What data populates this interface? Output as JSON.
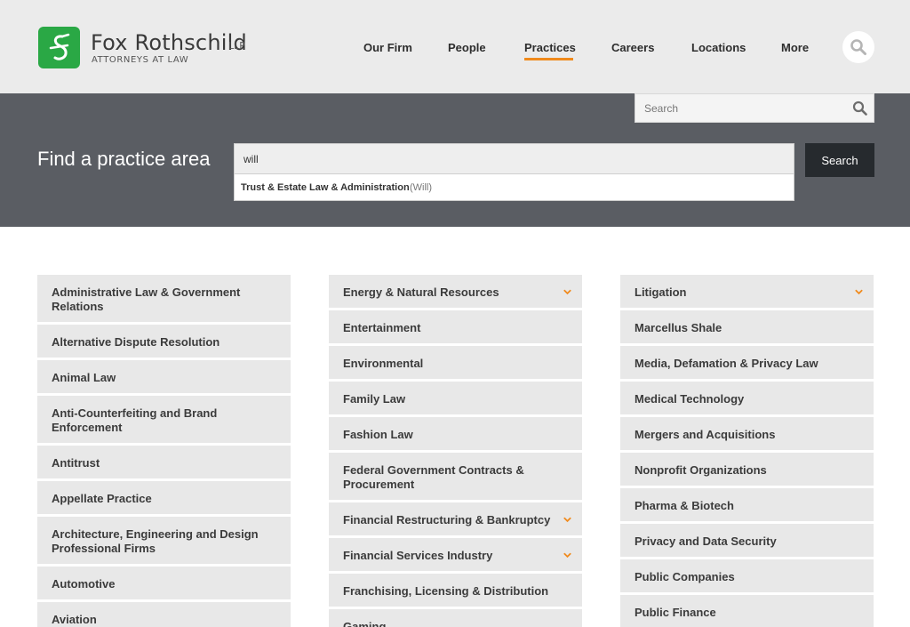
{
  "brand": {
    "name": "Fox Rothschild",
    "suffix": "LLP",
    "tagline": "ATTORNEYS AT LAW",
    "color": "#2aa845"
  },
  "nav": {
    "items": [
      "Our Firm",
      "People",
      "Practices",
      "Careers",
      "Locations",
      "More"
    ],
    "active": "Practices",
    "accent_color": "#f08a1c"
  },
  "site_search": {
    "placeholder": "Search"
  },
  "finder": {
    "title": "Find a practice area",
    "input_value": "will",
    "suggestion_main": "Trust & Estate Law & Administration",
    "suggestion_sub": "(Will)",
    "button_label": "Search"
  },
  "practices": {
    "col1": [
      {
        "label": "Administrative Law & Government Relations",
        "expandable": false
      },
      {
        "label": "Alternative Dispute Resolution",
        "expandable": false
      },
      {
        "label": "Animal Law",
        "expandable": false
      },
      {
        "label": "Anti-Counterfeiting and Brand Enforcement",
        "expandable": false
      },
      {
        "label": "Antitrust",
        "expandable": false
      },
      {
        "label": "Appellate Practice",
        "expandable": false
      },
      {
        "label": "Architecture, Engineering and Design Professional Firms",
        "expandable": false
      },
      {
        "label": "Automotive",
        "expandable": false
      },
      {
        "label": "Aviation",
        "expandable": false
      }
    ],
    "col2": [
      {
        "label": "Energy & Natural Resources",
        "expandable": true
      },
      {
        "label": "Entertainment",
        "expandable": false
      },
      {
        "label": "Environmental",
        "expandable": false
      },
      {
        "label": "Family Law",
        "expandable": false
      },
      {
        "label": "Fashion Law",
        "expandable": false
      },
      {
        "label": "Federal Government Contracts & Procurement",
        "expandable": false
      },
      {
        "label": "Financial Restructuring & Bankruptcy",
        "expandable": true
      },
      {
        "label": "Financial Services Industry",
        "expandable": true
      },
      {
        "label": "Franchising, Licensing & Distribution",
        "expandable": false
      },
      {
        "label": "Gaming",
        "expandable": false
      }
    ],
    "col3": [
      {
        "label": "Litigation",
        "expandable": true
      },
      {
        "label": "Marcellus Shale",
        "expandable": false
      },
      {
        "label": "Media, Defamation & Privacy Law",
        "expandable": false
      },
      {
        "label": "Medical Technology",
        "expandable": false
      },
      {
        "label": "Mergers and Acquisitions",
        "expandable": false
      },
      {
        "label": "Nonprofit Organizations",
        "expandable": false
      },
      {
        "label": "Pharma & Biotech",
        "expandable": false
      },
      {
        "label": "Privacy and Data Security",
        "expandable": false
      },
      {
        "label": "Public Companies",
        "expandable": false
      },
      {
        "label": "Public Finance",
        "expandable": false
      }
    ]
  }
}
